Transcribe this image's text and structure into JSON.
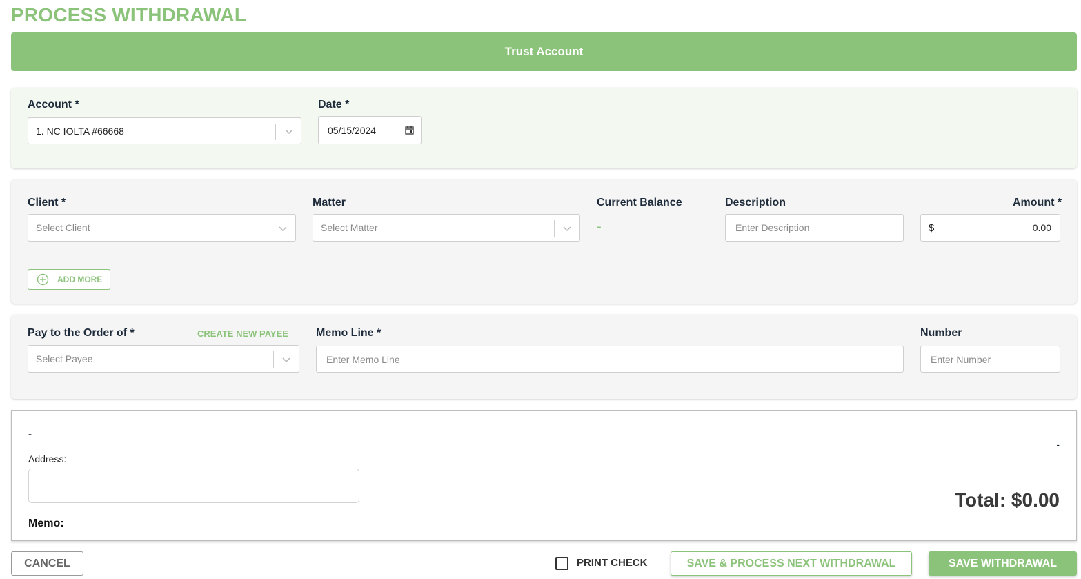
{
  "page_title": "PROCESS WITHDRAWAL",
  "banner": "Trust Account",
  "account_section": {
    "account_label": "Account *",
    "account_value": "1. NC IOLTA #66668",
    "date_label": "Date *",
    "date_value": "05/15/2024"
  },
  "line_item": {
    "client_label": "Client *",
    "client_placeholder": "Select Client",
    "matter_label": "Matter",
    "matter_placeholder": "Select Matter",
    "balance_label": "Current Balance",
    "balance_value": "-",
    "description_label": "Description",
    "description_placeholder": "Enter Description",
    "amount_label": "Amount *",
    "amount_currency": "$",
    "amount_value": "0.00",
    "add_more_label": "ADD MORE"
  },
  "payee_section": {
    "payee_label": "Pay to the Order of *",
    "create_payee_label": "CREATE NEW PAYEE",
    "payee_placeholder": "Select Payee",
    "memo_label": "Memo Line *",
    "memo_placeholder": "Enter Memo Line",
    "number_label": "Number",
    "number_placeholder": "Enter Number"
  },
  "check_preview": {
    "payee_name": "-",
    "right_dash": "-",
    "address_label": "Address:",
    "memo_label": "Memo:",
    "total": "Total: $0.00"
  },
  "footer": {
    "cancel_label": "CANCEL",
    "print_check_label": "PRINT CHECK",
    "save_next_label": "SAVE & PROCESS NEXT WITHDRAWAL",
    "save_label": "SAVE WITHDRAWAL"
  },
  "colors": {
    "accent": "#8cc37b",
    "text": "#1e2b3a"
  }
}
